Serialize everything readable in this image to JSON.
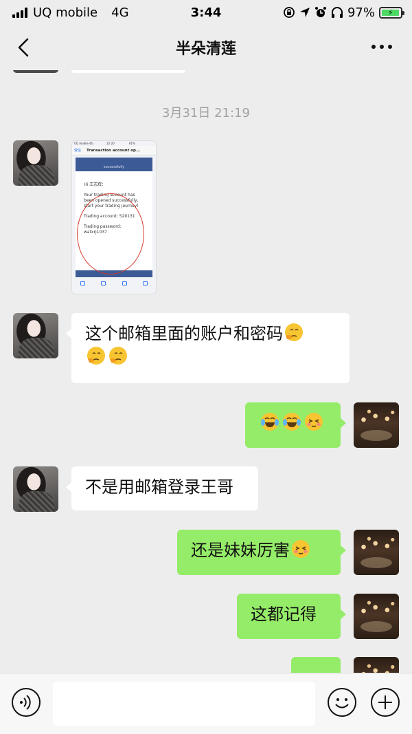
{
  "status_bar": {
    "carrier": "UQ mobile",
    "network": "4G",
    "time": "3:44",
    "battery": "97%"
  },
  "nav": {
    "title": "半朵清莲",
    "back_icon": "chevron-left-icon",
    "more_icon": "more-dots-icon"
  },
  "chat": {
    "timestamp": "3月31日 21:19",
    "screenshot_image": {
      "status_left": "UQ mobile 4G",
      "status_time": "22:20",
      "status_right": "61%",
      "back_label": "受信",
      "title": "Transaction account op...",
      "banner_text": "successfully",
      "greeting": "Hi 王志辉：",
      "line1": "Your trading account has been opened successfully, start your trading journey!",
      "line2": "Trading account: 520131",
      "line3": "Trading password: watxrj1037"
    },
    "messages": [
      {
        "side": "left",
        "text": "这个邮箱里面的账户和密码",
        "emoji_after": [
          "thinking-face-emoji"
        ],
        "line2_emoji": [
          "thinking-face-emoji",
          "thinking-face-emoji"
        ]
      },
      {
        "side": "right",
        "text": "",
        "emojis": [
          "tears-of-joy-emoji",
          "tears-of-joy-emoji",
          "blushing-emoji"
        ]
      },
      {
        "side": "left",
        "text": "不是用邮箱登录王哥"
      },
      {
        "side": "right",
        "text": "还是妹妹厉害",
        "emojis": [
          "blushing-emoji"
        ]
      },
      {
        "side": "right",
        "text": "这都记得"
      }
    ]
  },
  "input_bar": {
    "placeholder": "",
    "value": ""
  },
  "colors": {
    "background": "#ededed",
    "bubble_mine": "#95ec69",
    "bubble_theirs": "#ffffff"
  }
}
